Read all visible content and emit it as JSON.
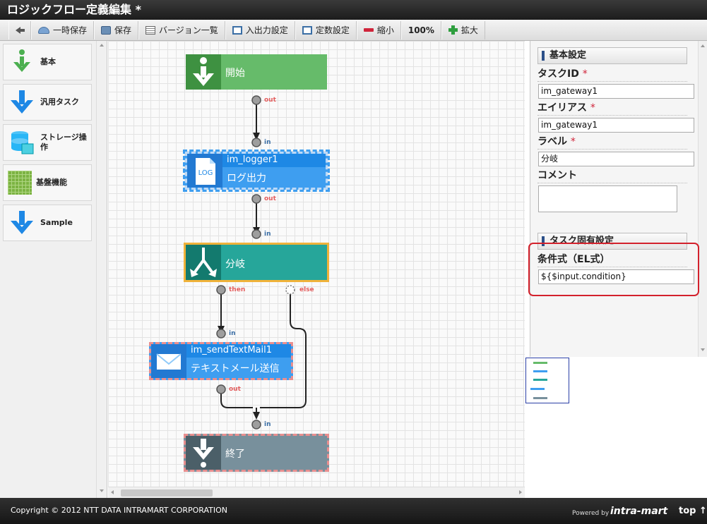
{
  "window": {
    "title": "ロジックフロー定義編集  *"
  },
  "toolbar": {
    "back_icon": "back-arrow-icon",
    "temp_save": "一時保存",
    "save": "保存",
    "version_list": "バージョン一覧",
    "io_settings": "入出力設定",
    "const_settings": "定数設定",
    "zoom_out": "縮小",
    "zoom_level": "100%",
    "zoom_in": "拡大"
  },
  "palette": {
    "items": [
      {
        "label": "基本",
        "icon": "info-down-icon"
      },
      {
        "label": "汎用タスク",
        "icon": "blue-down-arrow-icon"
      },
      {
        "label": "ストレージ操作",
        "icon": "database-icon"
      },
      {
        "label": "基盤機能",
        "icon": "grid-icon"
      },
      {
        "label": "Sample",
        "icon": "blue-down-arrow-icon"
      }
    ]
  },
  "flow": {
    "start": {
      "label": "開始",
      "port_out": "out"
    },
    "logger": {
      "id": "im_logger1",
      "label": "ログ出力",
      "icon_text": "LOG",
      "port_in": "in",
      "port_out": "out"
    },
    "gateway": {
      "label": "分岐",
      "port_in": "in",
      "port_then": "then",
      "port_else": "else"
    },
    "mail": {
      "id": "im_sendTextMail1",
      "label": "テキストメール送信",
      "port_in": "in",
      "port_out": "out"
    },
    "end": {
      "label": "終了",
      "port_in": "in"
    }
  },
  "properties": {
    "basic_section": "基本設定",
    "task_id_label": "タスクID",
    "task_id_value": "im_gateway1",
    "alias_label": "エイリアス",
    "alias_value": "im_gateway1",
    "label_label": "ラベル",
    "label_value": "分岐",
    "comment_label": "コメント",
    "required_mark": "*",
    "specific_section": "タスク固有設定",
    "condition_label": "条件式（EL式）",
    "condition_value": "${$input.condition}"
  },
  "colors": {
    "start": "#66bb6a",
    "start_dark": "#3e9141",
    "logger": "#3e9ef0",
    "logger_dark": "#2279d2",
    "gateway": "#26a69a",
    "gateway_dark": "#137a6e",
    "mail": "#3e9ef0",
    "mail_dark": "#2279d2",
    "end": "#78909c",
    "end_dark": "#4b5f68",
    "highlight": "#d3212c"
  },
  "footer": {
    "copyright": "Copyright © 2012 NTT DATA INTRAMART CORPORATION",
    "powered_by": "Powered by",
    "brand": "intra-mart",
    "top_link": "top ↑"
  }
}
